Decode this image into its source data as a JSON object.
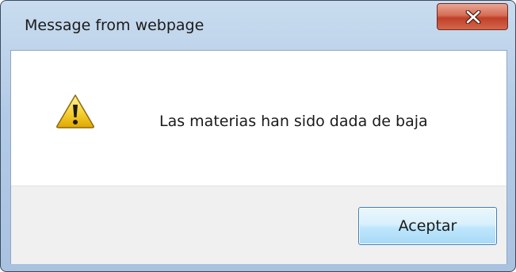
{
  "dialog": {
    "title": "Message from webpage",
    "message": "Las materias han sido dada de baja",
    "ok_label": "Aceptar",
    "close_glyph": "x",
    "icon": "warning-icon"
  },
  "colors": {
    "titlebar": "#b3cbe6",
    "close_button": "#c0402a",
    "footer": "#f0f0f0",
    "ok_button_border": "#3c7fb1"
  }
}
